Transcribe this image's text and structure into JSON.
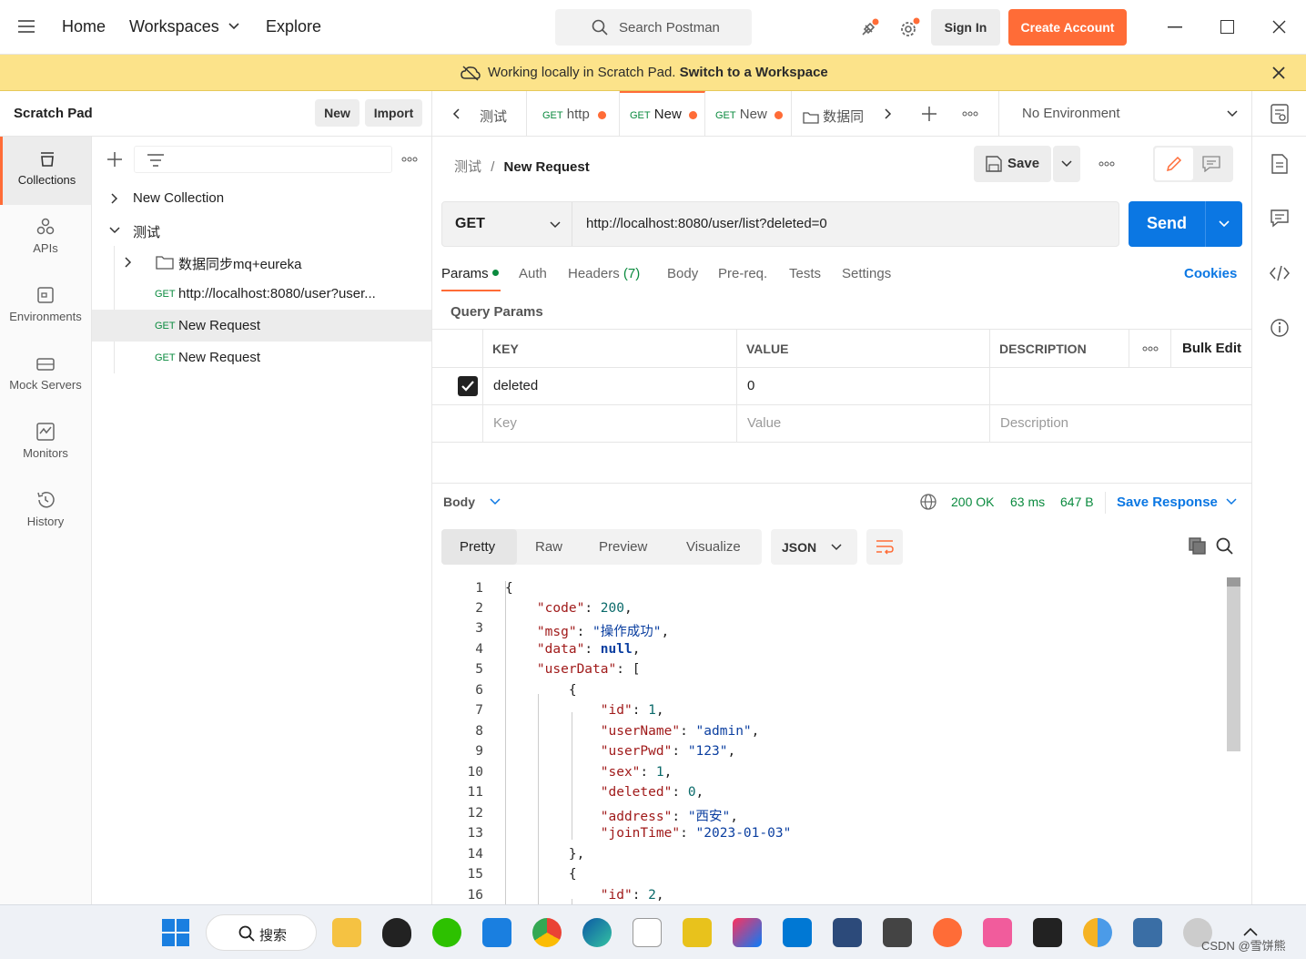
{
  "topbar": {
    "nav": [
      "Home",
      "Workspaces",
      "Explore"
    ],
    "search_placeholder": "Search Postman",
    "sign_in": "Sign In",
    "create_account": "Create Account"
  },
  "banner": {
    "text": "Working locally in Scratch Pad.",
    "link": "Switch to a Workspace"
  },
  "scratch": {
    "title": "Scratch Pad",
    "new": "New",
    "import": "Import"
  },
  "sidenav": [
    "Collections",
    "APIs",
    "Environments",
    "Mock Servers",
    "Monitors",
    "History"
  ],
  "tree": {
    "items": [
      {
        "label": "New Collection"
      },
      {
        "label": "测试"
      },
      {
        "label": "数据同步mq+eureka"
      },
      {
        "method": "GET",
        "label": "http://localhost:8080/user?user..."
      },
      {
        "method": "GET",
        "label": "New Request"
      },
      {
        "method": "GET",
        "label": "New Request"
      }
    ]
  },
  "tabs": [
    {
      "label": "测试"
    },
    {
      "method": "GET",
      "label": "http"
    },
    {
      "method": "GET",
      "label": "New"
    },
    {
      "method": "GET",
      "label": "New"
    },
    {
      "label": "数据同"
    }
  ],
  "environment": "No Environment",
  "request": {
    "breadcrumb_parent": "测试",
    "breadcrumb_sep": "/",
    "name": "New Request",
    "save": "Save",
    "method": "GET",
    "url": "http://localhost:8080/user/list?deleted=0",
    "send": "Send"
  },
  "req_tabs": [
    "Params",
    "Auth",
    "Headers",
    "(7)",
    "Body",
    "Pre-req.",
    "Tests",
    "Settings"
  ],
  "cookies": "Cookies",
  "query_params": {
    "title": "Query Params",
    "headers": [
      "KEY",
      "VALUE",
      "DESCRIPTION"
    ],
    "bulk_edit": "Bulk Edit",
    "rows": [
      {
        "key": "deleted",
        "value": "0",
        "checked": true
      }
    ],
    "placeholders": {
      "key": "Key",
      "value": "Value",
      "description": "Description"
    }
  },
  "response": {
    "section": "Body",
    "status": "200 OK",
    "time": "63 ms",
    "size": "647 B",
    "save": "Save Response",
    "views": [
      "Pretty",
      "Raw",
      "Preview",
      "Visualize"
    ],
    "format": "JSON"
  },
  "code_lines": [
    "1",
    "2",
    "3",
    "4",
    "5",
    "6",
    "7",
    "8",
    "9",
    "10",
    "11",
    "12",
    "13",
    "14",
    "15",
    "16"
  ],
  "taskbar": {
    "search": "搜索",
    "watermark": "CSDN @雪饼熊"
  },
  "colors": {
    "accent": "#ff6c37",
    "send_blue": "#0b77e3",
    "banner": "#fce38a",
    "status_green": "#0a8a3e"
  }
}
